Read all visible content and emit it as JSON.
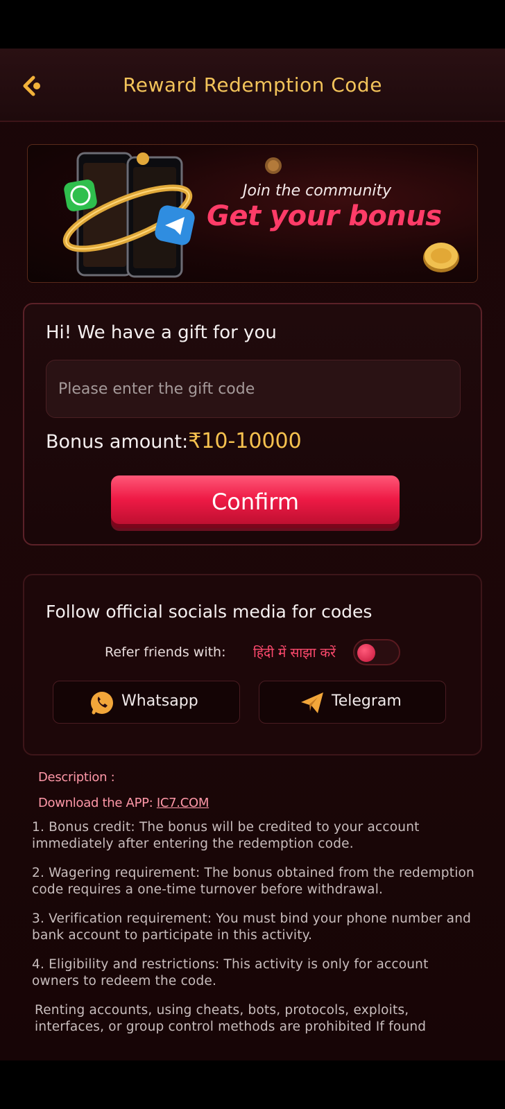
{
  "header": {
    "title": "Reward Redemption Code",
    "back_icon": "back-arrow-icon",
    "accent": "#f2c35a"
  },
  "banner": {
    "small_text": "Join the community",
    "big_text": "Get your bonus"
  },
  "gift": {
    "title": "Hi! We have a gift for you",
    "input_placeholder": "Please enter the gift code",
    "input_value": "",
    "bonus_label": "Bonus amount:",
    "bonus_value": "₹10-10000",
    "confirm_label": "Confirm"
  },
  "social": {
    "title": "Follow official socials media for codes",
    "refer_label": "Refer friends with:",
    "refer_hindi": "हिंदी में साझा करें",
    "toggle_on": false,
    "whatsapp_label": "Whatsapp",
    "telegram_label": "Telegram"
  },
  "description": {
    "label": "Description :",
    "download_prefix": "Download the APP: ",
    "download_link": "IC7.COM",
    "rules": [
      "1. Bonus credit: The bonus will be credited to your account immediately after entering the redemption code.",
      "2. Wagering requirement: The bonus obtained from the redemption code requires a one-time turnover before withdrawal.",
      "3. Verification requirement: You must bind your phone number and bank account to participate in this activity.",
      "4. Eligibility and restrictions: This activity is only for account owners to redeem the code.",
      "Renting accounts, using cheats, bots, protocols, exploits, interfaces, or group control methods are prohibited If found"
    ]
  },
  "colors": {
    "brand_pink": "#ff3c68",
    "gold": "#f6c24f",
    "background": "#1a0608"
  }
}
